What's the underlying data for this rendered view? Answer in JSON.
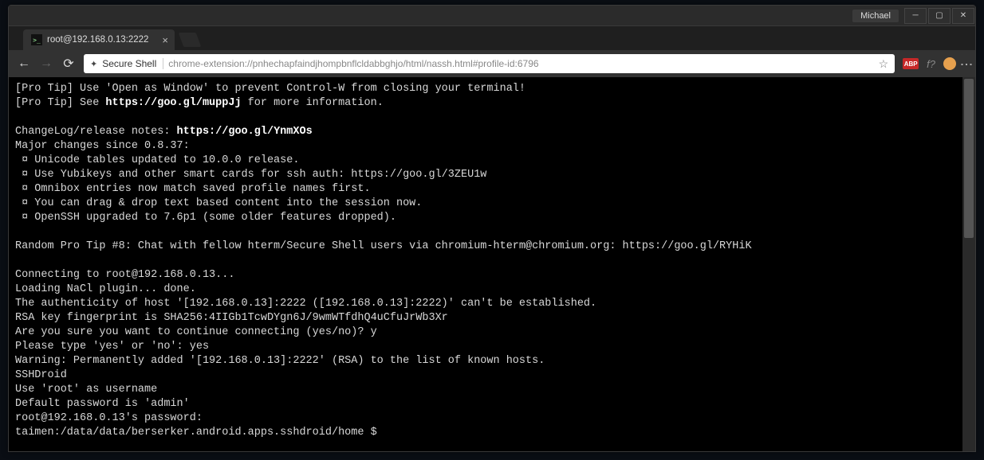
{
  "window": {
    "user_label": "Michael"
  },
  "tab": {
    "title": "root@192.168.0.13:2222",
    "favicon_text": ">_"
  },
  "omnibox": {
    "ext_name": "Secure Shell",
    "url": "chrome-extension://pnhechapfaindjhompbnflcldabbghjo/html/nassh.html#profile-id:6796"
  },
  "ext_badges": {
    "abp": "ABP",
    "f": "f?"
  },
  "term": {
    "l1a": "[Pro Tip] Use 'Open as Window' to prevent Control-W from closing your terminal!",
    "l2a": "[Pro Tip] See ",
    "l2b": "https://goo.gl/muppJj",
    "l2c": " for more information.",
    "l3": "",
    "l4a": "ChangeLog/release notes: ",
    "l4b": "https://goo.gl/YnmXOs",
    "l5": "Major changes since 0.8.37:",
    "l6": " ¤ Unicode tables updated to 10.0.0 release.",
    "l7": " ¤ Use Yubikeys and other smart cards for ssh auth: https://goo.gl/3ZEU1w",
    "l8": " ¤ Omnibox entries now match saved profile names first.",
    "l9": " ¤ You can drag & drop text based content into the session now.",
    "l10": " ¤ OpenSSH upgraded to 7.6p1 (some older features dropped).",
    "l11": "",
    "l12": "Random Pro Tip #8: Chat with fellow hterm/Secure Shell users via chromium-hterm@chromium.org: https://goo.gl/RYHiK",
    "l13": "",
    "l14": "Connecting to root@192.168.0.13...",
    "l15": "Loading NaCl plugin... done.",
    "l16": "The authenticity of host '[192.168.0.13]:2222 ([192.168.0.13]:2222)' can't be established.",
    "l17": "RSA key fingerprint is SHA256:4IIGb1TcwDYgn6J/9wmWTfdhQ4uCfuJrWb3Xr",
    "l18": "Are you sure you want to continue connecting (yes/no)? y",
    "l19": "Please type 'yes' or 'no': yes",
    "l20": "Warning: Permanently added '[192.168.0.13]:2222' (RSA) to the list of known hosts.",
    "l21": "SSHDroid",
    "l22": "Use 'root' as username",
    "l23": "Default password is 'admin'",
    "l24": "root@192.168.0.13's password:",
    "l25": "taimen:/data/data/berserker.android.apps.sshdroid/home $"
  }
}
